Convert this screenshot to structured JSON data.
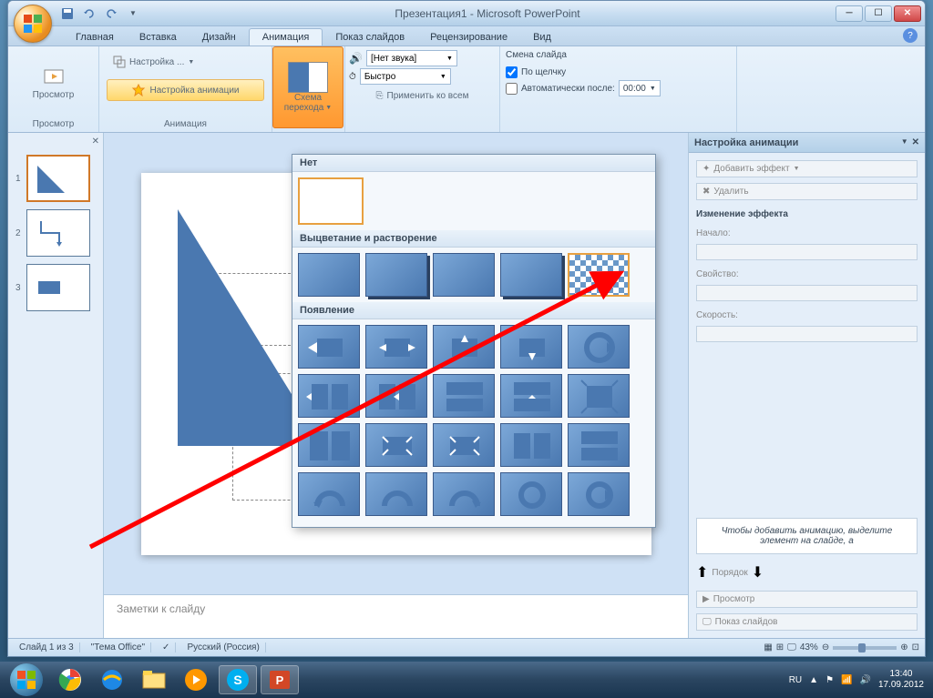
{
  "title": "Презентация1 - Microsoft PowerPoint",
  "tabs": {
    "home": "Главная",
    "insert": "Вставка",
    "design": "Дизайн",
    "animation": "Анимация",
    "slideshow": "Показ слайдов",
    "review": "Рецензирование",
    "view": "Вид"
  },
  "ribbon": {
    "preview": "Просмотр",
    "preview_group": "Просмотр",
    "custom": "Настройка ...",
    "custom_anim": "Настройка анимации",
    "anim_group": "Анимация",
    "scheme": "Схема",
    "transition": "перехода",
    "sound_label": "[Нет звука]",
    "speed_label": "Быстро",
    "apply_all": "Применить ко всем",
    "advance_title": "Смена слайда",
    "on_click": "По щелчку",
    "auto_after": "Автоматически после:",
    "auto_time": "00:00"
  },
  "gallery": {
    "none": "Нет",
    "fade": "Выцветание и растворение",
    "appear": "Появление"
  },
  "taskpane": {
    "title": "Настройка анимации",
    "add_effect": "Добавить эффект",
    "remove": "Удалить",
    "modify": "Изменение эффекта",
    "start": "Начало:",
    "property": "Свойство:",
    "speed": "Скорость:",
    "hint": "Чтобы добавить анимацию, выделите элемент на слайде, а",
    "order": "Порядок",
    "play": "Просмотр",
    "slideshow": "Показ слайдов"
  },
  "notes": "Заметки к слайду",
  "status": {
    "slide": "Слайд 1 из 3",
    "theme": "\"Тема Office\"",
    "lang": "Русский (Россия)",
    "zoom": "43%"
  },
  "tray": {
    "lang": "RU",
    "time": "13:40",
    "date": "17.09.2012"
  }
}
